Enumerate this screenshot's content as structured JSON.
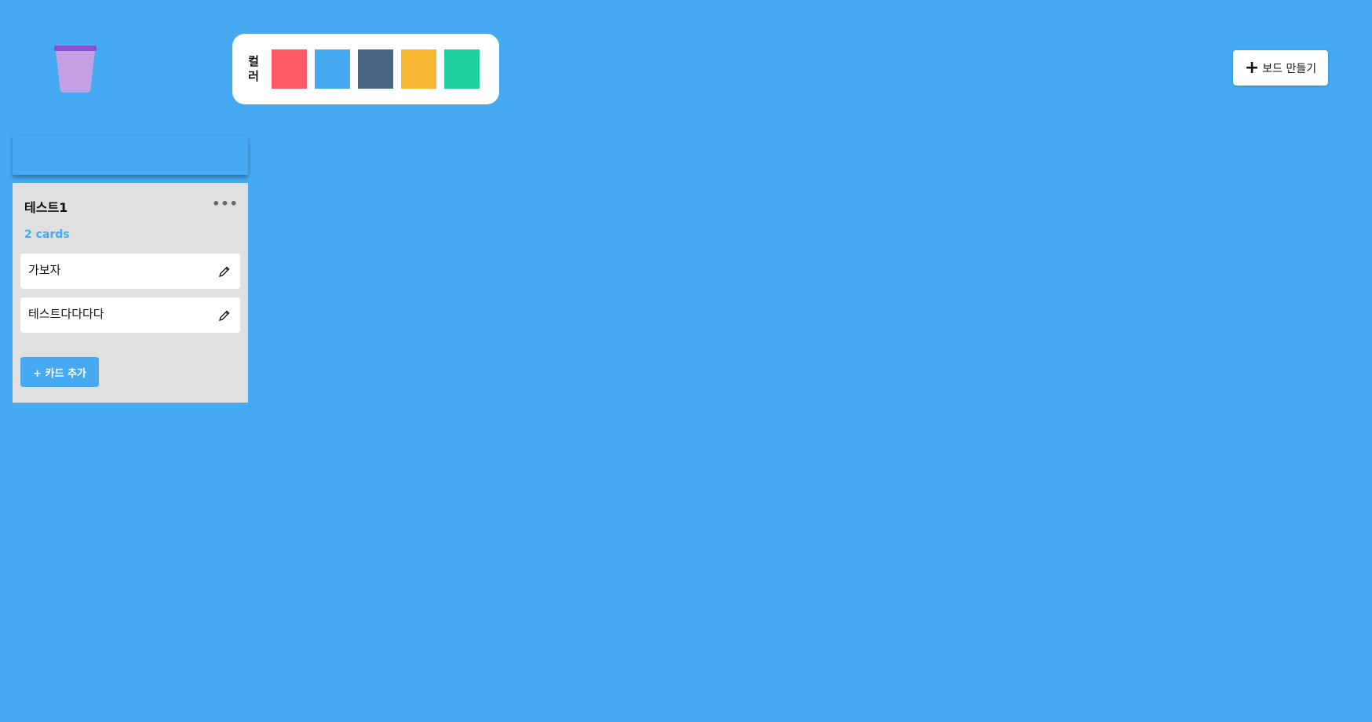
{
  "palette": {
    "label": "컬러",
    "colors": [
      "#fc5c65",
      "#45aaf2",
      "#4b6584",
      "#fed330",
      "#26de81"
    ]
  },
  "toolbar": {
    "create_board_icon": "+",
    "create_board_label": "보드 만들기"
  },
  "list": {
    "title": "테스트1",
    "menu_icon": "•••",
    "card_count": "2 cards",
    "cards": [
      {
        "text": "가보자"
      },
      {
        "text": "테스트다다다다"
      }
    ],
    "add_card_label": "+ 카드 추가"
  },
  "colors": {
    "background": "#45aaf2",
    "list_background": "#e0e0e0",
    "trash": "#c3a0e4",
    "trash_lid": "#8854d0"
  }
}
